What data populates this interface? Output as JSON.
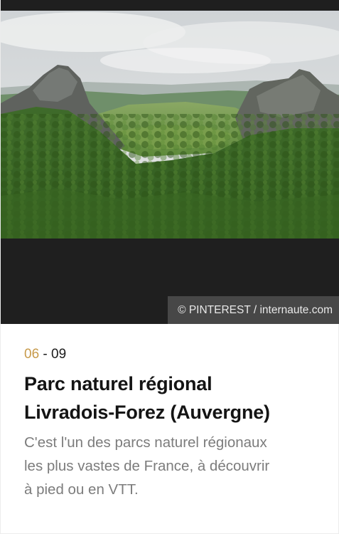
{
  "slide": {
    "credit": "© PINTEREST / internaute.com",
    "counter_current": "06",
    "counter_separator": " - ",
    "counter_total": "09",
    "title_line1": "Parc naturel régional",
    "title_line2": "Livradois-Forez (Auvergne)",
    "description_line1": "C'est l'un des parcs naturel régionaux",
    "description_line2": "les plus vastes de France, à découvrir",
    "description_line3": "à pied ou en VTT."
  },
  "colors": {
    "accent": "#c79a4a",
    "dark_band": "#1f1f1f",
    "title": "#141414",
    "description": "#7c7c7c"
  }
}
